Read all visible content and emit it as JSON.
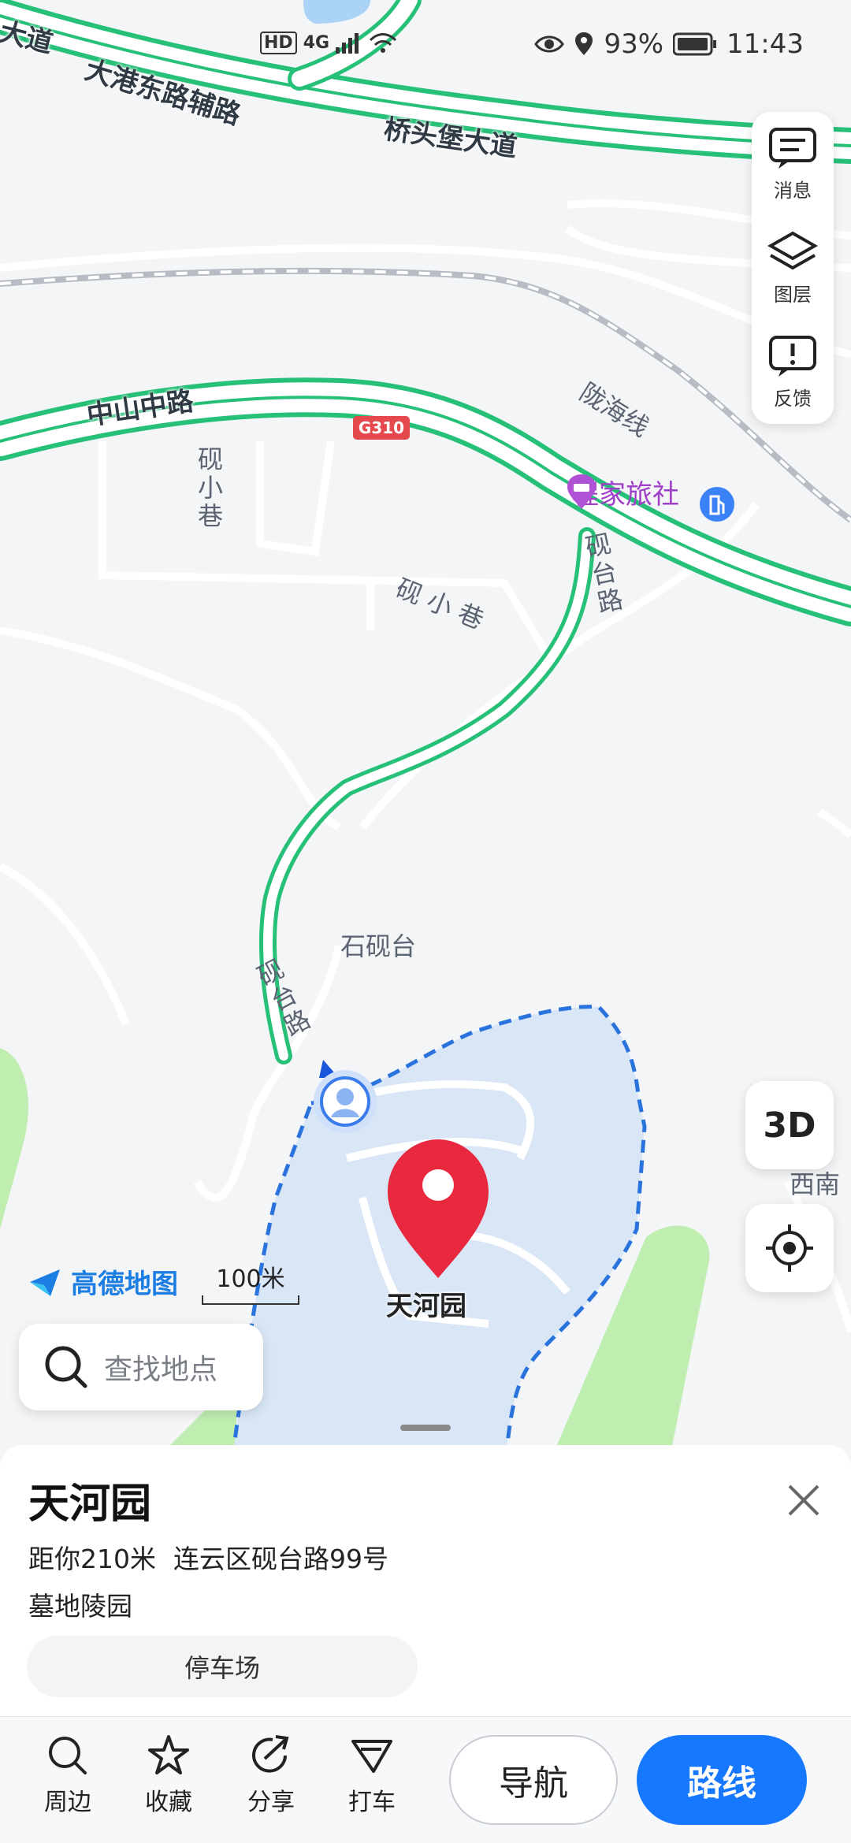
{
  "status_bar": {
    "battery": "93%",
    "time": "11:43",
    "network_badge": "HD",
    "network_type": "4G"
  },
  "map": {
    "road_labels": {
      "top_left": "大道",
      "dagang": "大港东路辅路",
      "qiaotoubao": "桥头堡大道",
      "zhongshan": "中山中路",
      "g310": "G310",
      "longhai": "陇海线",
      "yanxiaoxiang_v": "砚小巷",
      "yanxiaoxiang_h": "砚 小 巷",
      "yantai_upper": "砚台路",
      "yantai_lower": "砚台路"
    },
    "place_labels": {
      "shiyantai": "石砚台",
      "xinan": "西南",
      "poi_inn": "程家旅社",
      "destination": "天河园"
    },
    "zone_color": "#d8e6f6",
    "route_color": "#2fc47a",
    "pin_color": "#e8283f"
  },
  "side_panel": {
    "messages": "消息",
    "layers": "图层",
    "feedback": "反馈"
  },
  "controls": {
    "btn_3d": "3D"
  },
  "branding": {
    "logo_text": "高德地图",
    "scale": "100米"
  },
  "search": {
    "placeholder": "查找地点"
  },
  "place": {
    "name": "天河园",
    "distance": "距你210米",
    "address": "连云区砚台路99号",
    "category": "墓地陵园",
    "tag": "停车场"
  },
  "toolbar": {
    "nearby": "周边",
    "favorite": "收藏",
    "share": "分享",
    "taxi": "打车",
    "navigate": "导航",
    "route": "路线",
    "route_color": "#1677ff"
  }
}
